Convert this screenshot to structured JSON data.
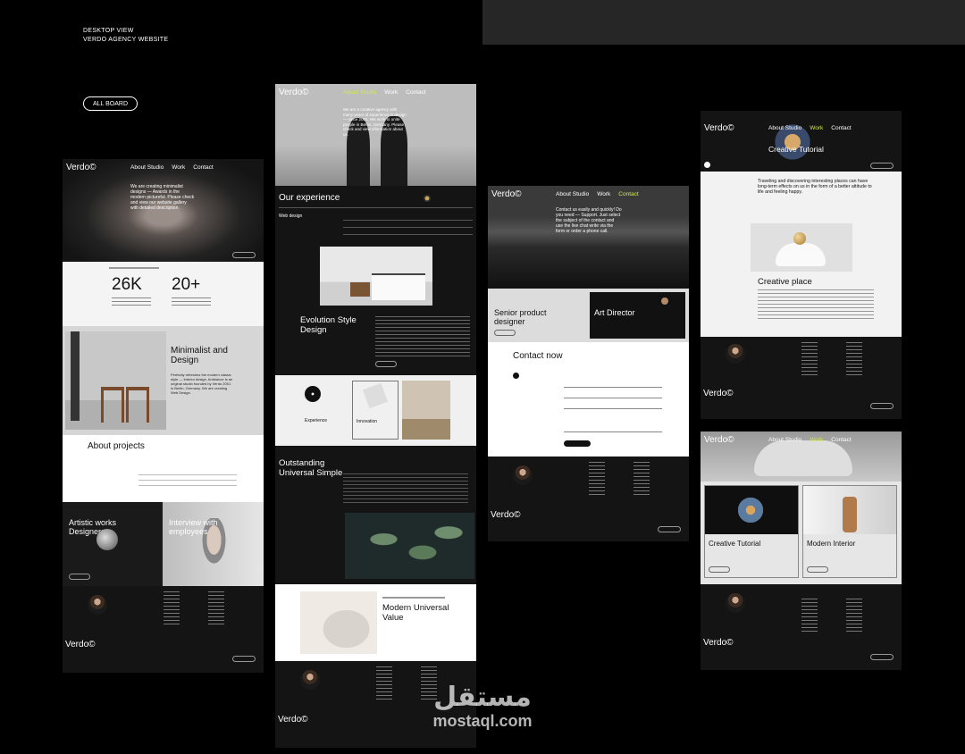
{
  "header": {
    "title": "DESKTOP VIEW",
    "subtitle": "VERDO AGENCY WEBSITE"
  },
  "board_button": "ALL BOARD",
  "mock1": {
    "logo": "Verdo©",
    "nav": [
      "About Studio",
      "Work",
      "Contact"
    ],
    "hero_text": "We are creating minimalist designs — Awards in the modern pictureful. Please check and view our website gallery with detailed description.",
    "stat1": "26K",
    "stat2": "20+",
    "minimal_title": "Minimalist and Design",
    "minimal_text": "Perfectly refreshes the modern classic style — Interior design. Ambiance is an original studio founded by Verdo 2001 in Berlin, Germany. We are creating Web Design.",
    "about_title": "About projects",
    "artistic_title": "Artistic works Designers",
    "interview_title": "Interview with employees",
    "footer_logo": "Verdo©"
  },
  "mock2": {
    "logo": "Verdo©",
    "nav": [
      "About Studio",
      "Work",
      "Contact"
    ],
    "hero_text": "We are a creative agency with many years of experience in design — since 2001. We work to unite people in Berlin, Germany. Please check and view information about us.",
    "experience_title": "Our experience",
    "web_design": "Web design",
    "evolution_title": "Evolution Style Design",
    "card1": "Experience",
    "card2": "Innovation",
    "outstanding_title": "Outstanding Universal Simple",
    "modern_title": "Modern Universal Value",
    "footer_logo": "Verdo©"
  },
  "mock3": {
    "logo": "Verdo©",
    "nav": [
      "About Studio",
      "Work",
      "Contact"
    ],
    "hero_text": "Contact us easily and quickly! Do you need — Support. Just select the subject of the contact and use the live chat write via the form or order a phone call.",
    "job1": "Senior product designer",
    "job2": "Art Director",
    "contact_title": "Contact now",
    "footer_logo": "Verdo©"
  },
  "mock4": {
    "logo": "Verdo©",
    "nav": [
      "About Studio",
      "Work",
      "Contact"
    ],
    "hero_title": "Creative Tutorial",
    "intro_text": "Traveling and discovering interesting places can have long-term effects on us in the form of a better attitude to life and feeling happy.",
    "creative_place": "Creative place",
    "footer_logo": "Verdo©"
  },
  "mock5": {
    "logo": "Verdo©",
    "nav": [
      "About Studio",
      "Work",
      "Contact"
    ],
    "card1": "Creative Tutorial",
    "card2": "Modern Interior",
    "footer_logo": "Verdo©"
  },
  "watermark": {
    "arabic": "مستقل",
    "latin": "mostaql.com"
  },
  "colors": {
    "accent": "#d4e84a",
    "dark": "#141414",
    "light": "#f2f2f2"
  }
}
